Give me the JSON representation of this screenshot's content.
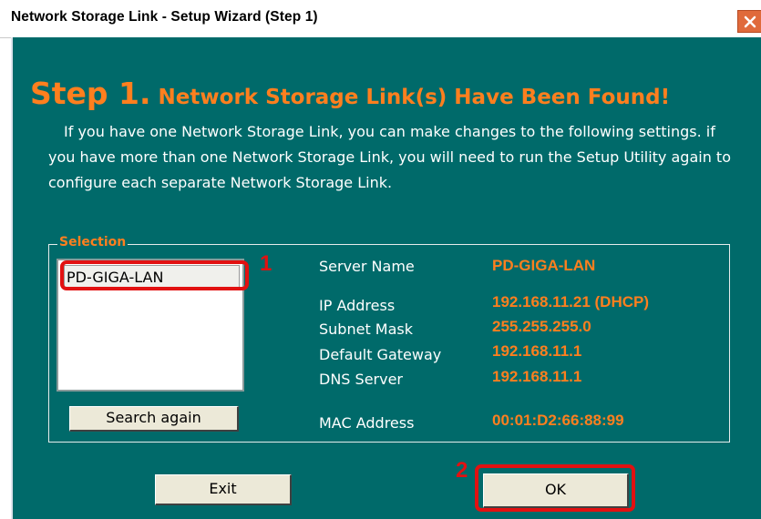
{
  "window": {
    "title": "Network Storage Link - Setup Wizard (Step 1)",
    "close_icon": "close-icon"
  },
  "header": {
    "step_number": "Step 1.",
    "step_title": "Network Storage Link(s) Have Been Found!"
  },
  "description": "If you have one Network Storage Link, you can make changes to the following settings. if you have more than one Network Storage Link, you will need to run the Setup Utility again to configure each separate Network Storage Link.",
  "selection": {
    "label": "Selection",
    "items": [
      "PD-GIGA-LAN"
    ],
    "selected": "PD-GIGA-LAN",
    "search_again_label": "Search again"
  },
  "details": {
    "server_name": {
      "label": "Server Name",
      "value": "PD-GIGA-LAN"
    },
    "ip_address": {
      "label": "IP Address",
      "value": "192.168.11.21 (DHCP)"
    },
    "subnet_mask": {
      "label": "Subnet Mask",
      "value": "255.255.255.0"
    },
    "default_gateway": {
      "label": "Default Gateway",
      "value": "192.168.11.1"
    },
    "dns_server": {
      "label": "DNS Server",
      "value": "192.168.11.1"
    },
    "mac_address": {
      "label": "MAC Address",
      "value": "00:01:D2:66:88:99"
    }
  },
  "buttons": {
    "exit_label": "Exit",
    "ok_label": "OK"
  },
  "annotations": {
    "marker_1": "1",
    "marker_2": "2"
  },
  "colors": {
    "background": "#006a6a",
    "accent": "#ff7f1e",
    "annotation": "#e21111"
  }
}
